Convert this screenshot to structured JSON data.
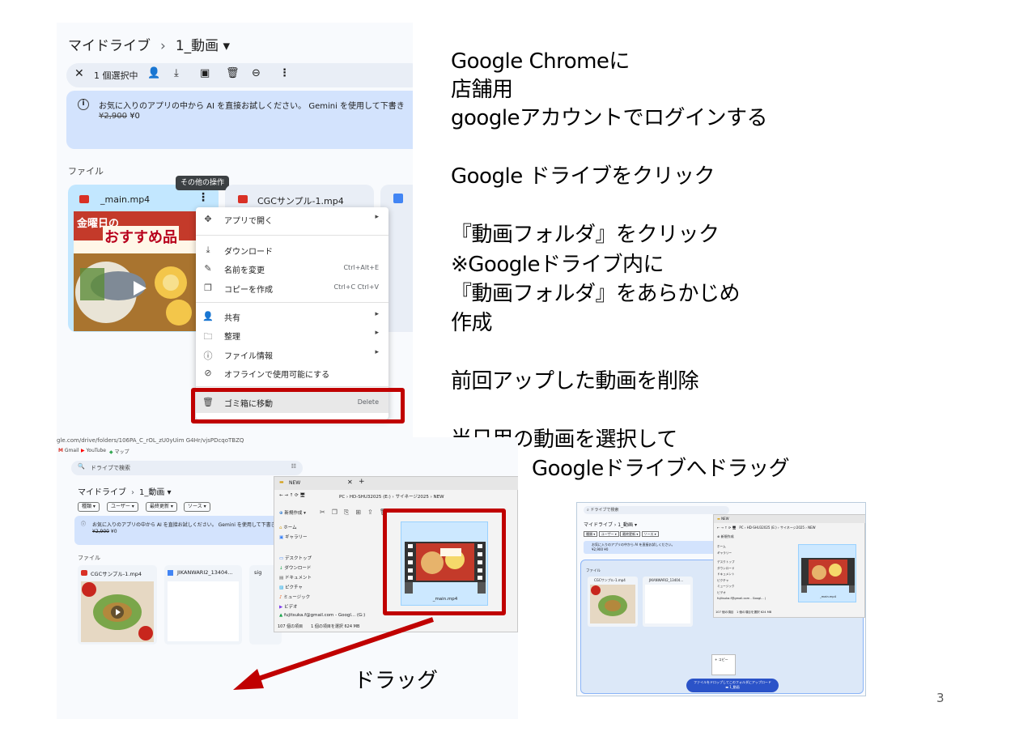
{
  "drive_top": {
    "breadcrumb_root": "マイドライブ",
    "breadcrumb_sep": "›",
    "breadcrumb_folder": "1_動画 ▾",
    "selection_count": "1 個選択中",
    "banner_text": "お気に入りのアプリの中から AI を直接お試しください。 Gemini を使用して下書き",
    "banner_price_old": "¥2,900",
    "banner_price_new": "¥0",
    "section_files": "ファイル",
    "tooltip": "その他の操作",
    "file1_name": "_main.mp4",
    "file2_name": "CGCサンプル-1.mp4",
    "thumb_text_line1": "金曜日の",
    "thumb_text_line2": "おすすめ品",
    "menu": {
      "open_with": "アプリで開く",
      "download": "ダウンロード",
      "rename": "名前を変更",
      "rename_shortcut": "Ctrl+Alt+E",
      "copy": "コピーを作成",
      "copy_shortcut": "Ctrl+C Ctrl+V",
      "share": "共有",
      "organize": "整理",
      "file_info": "ファイル情報",
      "offline": "オフラインで使用可能にする",
      "trash": "ゴミ箱に移動",
      "trash_shortcut": "Delete"
    }
  },
  "instructions": {
    "l1": "Google Chromeに",
    "l2": "店舗用",
    "l3": "googleアカウントでログインする",
    "l4": "Google ドライブをクリック",
    "l5": "『動画フォルダ』をクリック",
    "l6": "※Googleドライブ内に",
    "l7": "『動画フォルダ』をあらかじめ",
    "l8": "作成",
    "l9": "前回アップした動画を削除",
    "l10": "当日用の動画を選択して",
    "l11": "Googleドライブへドラッグ"
  },
  "drive_bottom": {
    "url": "gle.com/drive/folders/106PA_C_rOL_zU0yUim G4Hr/vjsPDcqoTBZQ",
    "bookmark_gmail": "Gmail",
    "bookmark_youtube": "YouTube",
    "bookmark_maps": "マップ",
    "search_placeholder": "ドライブで検索",
    "breadcrumb_root": "マイドライブ",
    "breadcrumb_sep": "›",
    "breadcrumb_folder": "1_動画 ▾",
    "chips": [
      "種類 ▾",
      "ユーザー ▾",
      "最終更新 ▾",
      "ソース ▾"
    ],
    "banner_text": "お気に入りのアプリの中から AI を直接お試しください。 Gemini を使用して下書きを生成",
    "banner_price_old": "¥2,900",
    "banner_price_new": "¥0",
    "section_files": "ファイル",
    "card1": "CGCサンプル-1.mp4",
    "card2": "JIKANWARI2_13404...",
    "card3": "sig",
    "explorer": {
      "title": "NEW",
      "path": [
        "PC",
        "HD-SHU32025 (E:)",
        "サイネージ2025",
        "NEW"
      ],
      "new_button": "新規作成 ▾",
      "nav": [
        "ホーム",
        "ギャラリー",
        "デスクトップ",
        "ダウンロード",
        "ドキュメント",
        "ピクチャ",
        "ミュージック",
        "ビデオ",
        "fujitsuka.f@gmail.com - Googl... (G:)"
      ],
      "file_name": "_main.mp4",
      "status": "107 個の項目　　1 個の項目を選択  624 MB"
    },
    "drag_label": "ドラッグ"
  },
  "drive_right": {
    "search_placeholder": "ドライブで検索",
    "breadcrumb": "1_動画 ▾",
    "chips": [
      "種類 ▾",
      "ユーザー ▾",
      "最終更新 ▾",
      "ソース ▾"
    ],
    "banner_text": "お気に入りのアプリの中から AI を直接お試しください。",
    "banner_price": "¥2,900 ¥0",
    "section_files": "ファイル",
    "card1": "CGCサンプル-1.mp4",
    "card2": "JIKANWARI2_13404...",
    "explorer_title": "NEW",
    "explorer_path": "PC › HD-SHU32025 (E:) › サイネージ2025 › NEW",
    "explorer_new": "新規作成",
    "explorer_nav": [
      "ホーム",
      "ギャラリー",
      "デスクトップ",
      "ダウンロード",
      "ドキュメント",
      "ピクチャ",
      "ミュージック",
      "ビデオ",
      "fujitsuka.f@gmail.com - Googl... (G:)"
    ],
    "explorer_status": "107 個の項目　1 個の項目を選択 624 MB",
    "file_name": "_main.mp4",
    "copy_label": "+ コピー",
    "upload_line1": "ファイルをドロップしてこのフォルダにアップロード",
    "upload_line2": "1_動画"
  },
  "page_number": "3",
  "colors": {
    "highlight_red": "#c00000",
    "drive_blue": "#d3e3fd",
    "upload_button": "#2b53c8"
  }
}
